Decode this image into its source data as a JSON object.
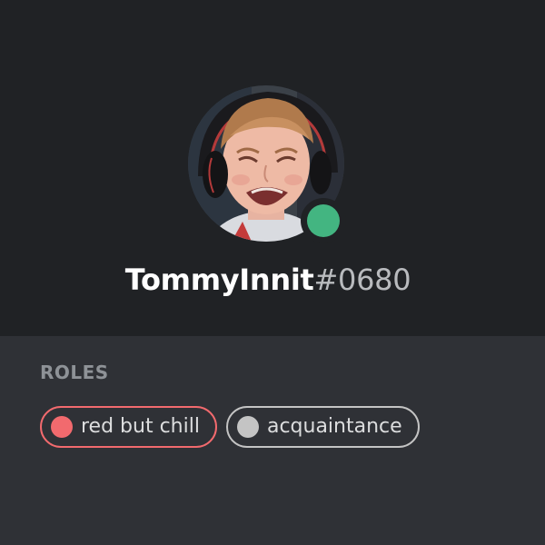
{
  "profile": {
    "username": "TommyInnit",
    "discriminator": "#0680",
    "avatar_icon": "user-avatar-photo",
    "status": "online",
    "status_color": "#43b581"
  },
  "roles": {
    "heading": "ROLES",
    "items": [
      {
        "label": "red but chill",
        "color": "#f26a6e"
      },
      {
        "label": "acquaintance",
        "color": "#c4c4c4"
      }
    ]
  },
  "colors": {
    "header_bg": "#202225",
    "body_bg": "#2f3136",
    "text_primary": "#ffffff",
    "text_muted": "#b9bbbe",
    "heading_muted": "#8e9297"
  }
}
